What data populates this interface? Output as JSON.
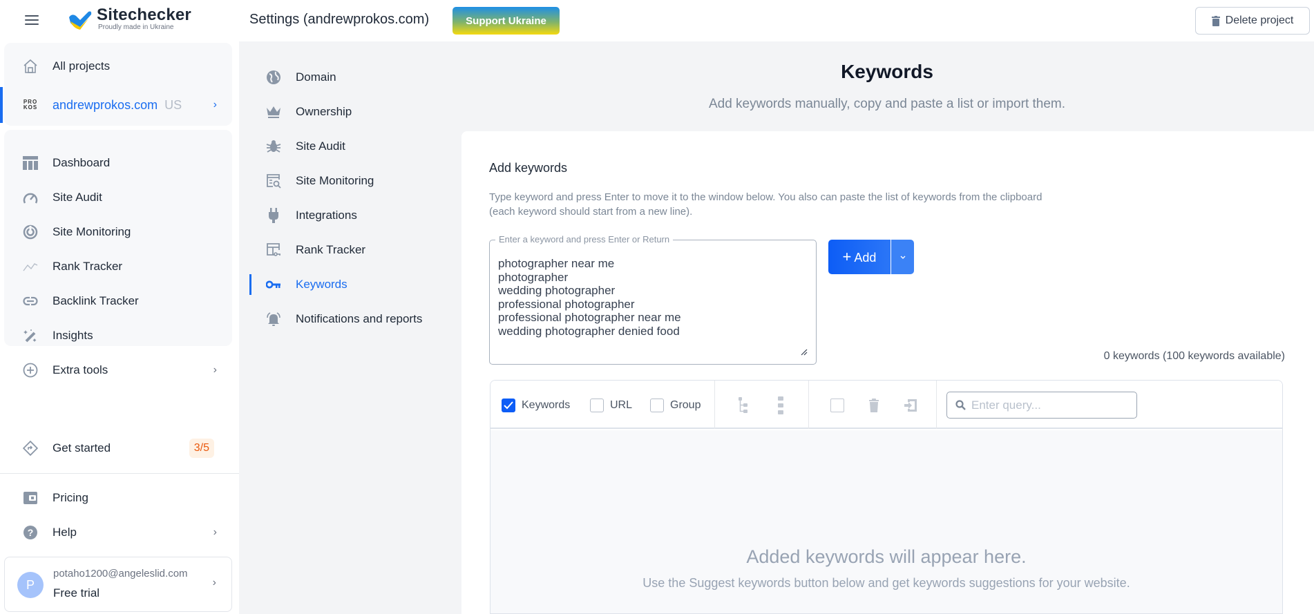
{
  "header": {
    "logo_title": "Sitechecker",
    "logo_subtitle": "Proudly made in Ukraine",
    "settings_title": "Settings (andrewprokos.com)",
    "support_button": "Support Ukraine",
    "delete_button": "Delete project"
  },
  "sidebar": {
    "all_projects": "All projects",
    "project": {
      "name": "andrewprokos.com",
      "country": "US",
      "logo_text": "PRO KOS"
    },
    "items": [
      {
        "label": "Dashboard",
        "icon": "dashboard-icon"
      },
      {
        "label": "Site Audit",
        "icon": "gauge-icon"
      },
      {
        "label": "Site Monitoring",
        "icon": "monitoring-icon"
      },
      {
        "label": "Rank Tracker",
        "icon": "trend-icon"
      },
      {
        "label": "Backlink Tracker",
        "icon": "link-icon"
      },
      {
        "label": "Insights",
        "icon": "magic-wand-icon"
      }
    ],
    "extra_tools": "Extra tools",
    "get_started": "Get started",
    "get_started_progress": "3/5",
    "pricing": "Pricing",
    "help": "Help",
    "user": {
      "initial": "P",
      "email": "potaho1200@angeleslid.com",
      "plan": "Free trial"
    }
  },
  "settings_nav": {
    "items": [
      {
        "label": "Domain",
        "icon": "globe-icon"
      },
      {
        "label": "Ownership",
        "icon": "crown-icon"
      },
      {
        "label": "Site Audit",
        "icon": "bug-icon"
      },
      {
        "label": "Site Monitoring",
        "icon": "monitor-search-icon"
      },
      {
        "label": "Integrations",
        "icon": "plug-icon"
      },
      {
        "label": "Rank Tracker",
        "icon": "rank-tracker-icon"
      },
      {
        "label": "Keywords",
        "icon": "key-icon"
      },
      {
        "label": "Notifications and reports",
        "icon": "bell-icon"
      }
    ],
    "active": "Keywords"
  },
  "main": {
    "title": "Keywords",
    "subtitle": "Add keywords manually, copy and paste a list or import them.",
    "add_section_title": "Add keywords",
    "add_description_line1": "Type keyword and press Enter to move it to the window below. You also can paste the list of keywords from the clipboard",
    "add_description_line2": "(each keyword should start from a new line).",
    "input_legend": "Enter a keyword and press Enter or Return",
    "input_value": "photographer near me\nphotographer\nwedding photographer\nprofessional photographer\nprofessional photographer near me\nwedding photographer denied food",
    "add_button": "Add",
    "keyword_count": "0 keywords (100 keywords available)",
    "table": {
      "filters": [
        {
          "label": "Keywords",
          "checked": true
        },
        {
          "label": "URL",
          "checked": false
        },
        {
          "label": "Group",
          "checked": false
        }
      ],
      "search_placeholder": "Enter query...",
      "empty_title": "Added keywords will appear here.",
      "empty_subtitle": "Use the Suggest keywords button below and get keywords suggestions for your website."
    }
  }
}
